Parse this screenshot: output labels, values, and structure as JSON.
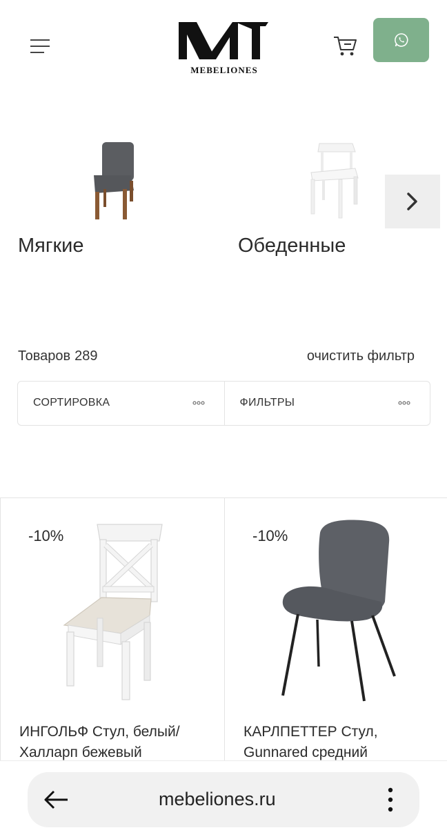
{
  "header": {
    "logo_text": "MEBELIONES",
    "colors": {
      "whatsapp_button": "#7fb08c"
    }
  },
  "categories": [
    {
      "label": "Мягкие"
    },
    {
      "label": "Обеденные"
    }
  ],
  "catalog": {
    "count_label": "Товаров",
    "count_value": "289",
    "clear_filter": "очистить фильтр"
  },
  "sort_bar": {
    "sort_label": "СОРТИРОВКА",
    "filters_label": "ФИЛЬТРЫ"
  },
  "products": [
    {
      "discount": "-10%",
      "title": "ИНГОЛЬФ Стул, белый/ Халларп бежевый"
    },
    {
      "discount": "-10%",
      "title": "КАРЛПЕТТЕР Стул, Gunnared средний"
    }
  ],
  "browser": {
    "url": "mebeliones.ru"
  }
}
